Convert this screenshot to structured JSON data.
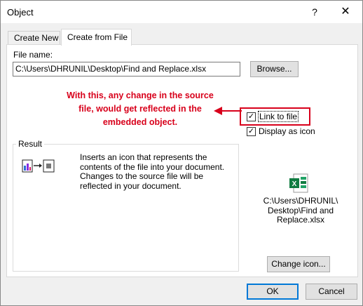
{
  "window": {
    "title": "Object",
    "help_label": "?",
    "close_label": "✕"
  },
  "tabs": [
    {
      "label": "Create New",
      "active": false
    },
    {
      "label": "Create from File",
      "active": true
    }
  ],
  "file": {
    "label": "File name:",
    "value": "C:\\Users\\DHRUNIL\\Desktop\\Find and Replace.xlsx",
    "browse_label": "Browse..."
  },
  "annotation": {
    "text": "With this, any change in the source file, would get reflected in the embedded object.",
    "color": "#d8001b"
  },
  "options": {
    "link_label": "Link to file",
    "link_checked": true,
    "display_label": "Display as icon",
    "display_checked": true
  },
  "result": {
    "label": "Result",
    "text": "Inserts an icon that represents the contents of the file into your document. Changes to the source file will be reflected in your document."
  },
  "icon_preview": {
    "icon": "excel-file-icon",
    "caption": "C:\\Users\\DHRUNIL\\ Desktop\\Find and Replace.xlsx",
    "change_label": "Change icon..."
  },
  "buttons": {
    "ok_label": "OK",
    "cancel_label": "Cancel",
    "accent": "#0078d7"
  }
}
